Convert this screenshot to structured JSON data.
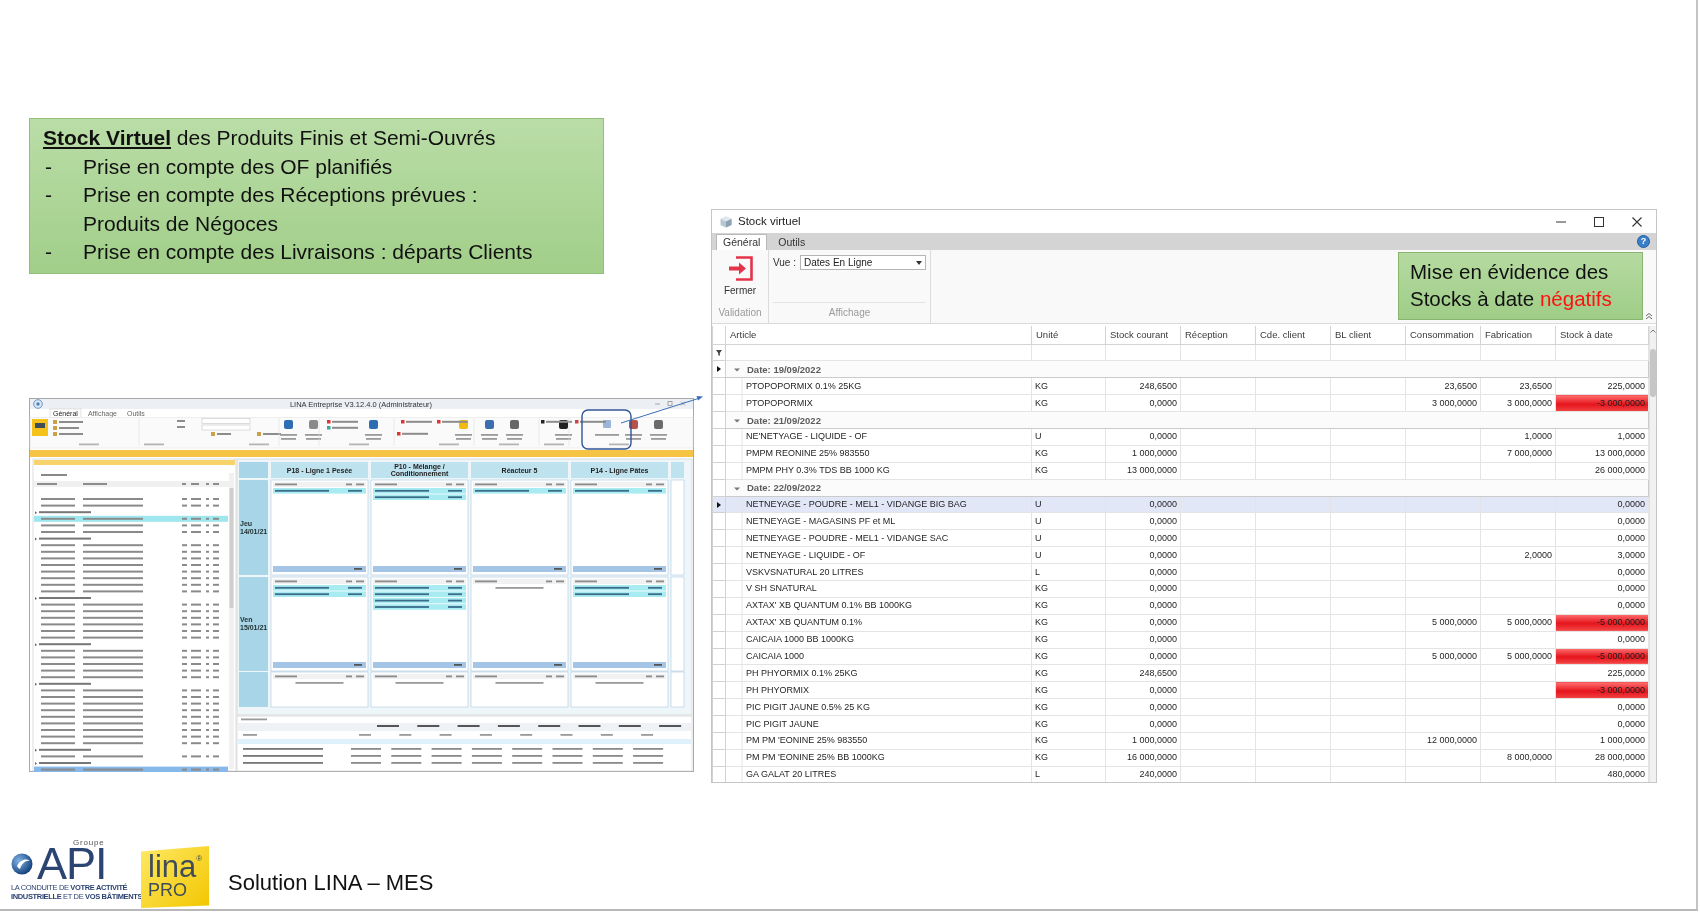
{
  "intro_box": {
    "title": "**Stock Virtuel** des Produits Finis et Semi-Ouvrés",
    "bullets": [
      {
        "marker": "-",
        "lines": [
          "Prise en compte des OF planifiés"
        ]
      },
      {
        "marker": "-",
        "lines": [
          "Prise en compte des Réceptions prévues :",
          "Produits de Négoces"
        ]
      },
      {
        "marker": "-",
        "lines": [
          "Prise en compte des Livraisons : départs Clients"
        ]
      }
    ]
  },
  "app_screenshot": {
    "title": "LINA Entreprise V3.12.4.0 (Administrateur)",
    "tabs": [
      {
        "label": "Général",
        "selected": true
      },
      {
        "label": "Affichage",
        "selected": false
      },
      {
        "label": "Outils",
        "selected": false
      }
    ],
    "resources": [
      "P18 - Ligne 1 Pesée",
      "P10 - Mélange / Conditionnement",
      "Réacteur 5",
      "P14 - Ligne Pâtes"
    ],
    "days": [
      {
        "day": "Jeu",
        "date": "14/01/21"
      },
      {
        "day": "Ven",
        "date": "15/01/21"
      }
    ]
  },
  "stock_window": {
    "title": "Stock virtuel",
    "tabs": [
      {
        "label": "Général",
        "selected": true
      },
      {
        "label": "Outils",
        "selected": false
      }
    ],
    "help_label": "?",
    "ribbon": {
      "groups": [
        {
          "kind": "buttons",
          "label": "Validation",
          "buttons": [
            "Fermer"
          ]
        },
        {
          "kind": "dropdown",
          "label": "Affichage",
          "field_label": "Vue :",
          "value": "Dates En Ligne"
        }
      ]
    },
    "callout": {
      "text": "Mise en évidence des Stocks à date",
      "highlight": "négatifs"
    },
    "table": {
      "columns": [
        "Article",
        "Unité",
        "Stock courant",
        "Réception",
        "Cde. client",
        "BL client",
        "Consommation",
        "Fabrication",
        "Stock à date"
      ],
      "groups": [
        {
          "label": "Date: 19/09/2022",
          "expanded": true,
          "selected": true,
          "rows": [
            {
              "article": "PTOPOPORMIX 0.1% 25KG",
              "unite": "KG",
              "stock_courant": "248,6500",
              "consommation": "23,6500",
              "fabrication": "23,6500",
              "stock_a_date": "225,0000",
              "negative": false,
              "selected": false
            },
            {
              "article": "PTOPOPORMIX",
              "unite": "KG",
              "stock_courant": "0,0000",
              "consommation": "3 000,0000",
              "fabrication": "3 000,0000",
              "stock_a_date": "-3 000,0000",
              "negative": true,
              "selected": false
            }
          ]
        },
        {
          "label": "Date: 21/09/2022",
          "expanded": true,
          "selected": false,
          "rows": [
            {
              "article": "NE'NETYAGE - LIQUIDE - OF",
              "unite": "U",
              "stock_courant": "0,0000",
              "fabrication": "1,0000",
              "stock_a_date": "1,0000",
              "negative": false,
              "selected": false
            },
            {
              "article": "PMPM REONINE 25% 983550",
              "unite": "KG",
              "stock_courant": "1 000,0000",
              "fabrication": "7 000,0000",
              "stock_a_date": "13 000,0000",
              "negative": false,
              "selected": false
            },
            {
              "article": "PMPM PHY 0.3% TDS BB 1000 KG",
              "unite": "KG",
              "stock_courant": "13 000,0000",
              "stock_a_date": "26 000,0000",
              "negative": false,
              "selected": false
            }
          ]
        },
        {
          "label": "Date: 22/09/2022",
          "expanded": true,
          "selected": false,
          "rows": [
            {
              "article": "NETNEYAGE - POUDRE - MEL1 - VIDANGE BIG BAG",
              "unite": "U",
              "stock_courant": "0,0000",
              "stock_a_date": "0,0000",
              "negative": false,
              "selected": true
            },
            {
              "article": "NETNEYAGE - MAGASINS PF et ML",
              "unite": "U",
              "stock_courant": "0,0000",
              "stock_a_date": "0,0000",
              "negative": false,
              "selected": false
            },
            {
              "article": "NETNEYAGE - POUDRE - MEL1 - VIDANGE SAC",
              "unite": "U",
              "stock_courant": "0,0000",
              "stock_a_date": "0,0000",
              "negative": false,
              "selected": false
            },
            {
              "article": "NETNEYAGE - LIQUIDE - OF",
              "unite": "U",
              "stock_courant": "0,0000",
              "fabrication": "2,0000",
              "stock_a_date": "3,0000",
              "negative": false,
              "selected": false
            },
            {
              "article": "VSKVSNATURAL 20 LITRES",
              "unite": "L",
              "stock_courant": "0,0000",
              "stock_a_date": "0,0000",
              "negative": false,
              "selected": false
            },
            {
              "article": "V SH SNATURAL",
              "unite": "KG",
              "stock_courant": "0,0000",
              "stock_a_date": "0,0000",
              "negative": false,
              "selected": false
            },
            {
              "article": "AXTAX' XB QUANTUM 0.1% BB 1000KG",
              "unite": "KG",
              "stock_courant": "0,0000",
              "stock_a_date": "0,0000",
              "negative": false,
              "selected": false
            },
            {
              "article": "AXTAX' XB QUANTUM 0.1%",
              "unite": "KG",
              "stock_courant": "0,0000",
              "consommation": "5 000,0000",
              "fabrication": "5 000,0000",
              "stock_a_date": "-5 000,0000",
              "negative": true,
              "selected": false
            },
            {
              "article": "CAICAIA 1000 BB 1000KG",
              "unite": "KG",
              "stock_courant": "0,0000",
              "stock_a_date": "0,0000",
              "negative": false,
              "selected": false
            },
            {
              "article": "CAICAIA 1000",
              "unite": "KG",
              "stock_courant": "0,0000",
              "consommation": "5 000,0000",
              "fabrication": "5 000,0000",
              "stock_a_date": "-5 000,0000",
              "negative": true,
              "selected": false
            },
            {
              "article": "PH PHYORMIX 0.1% 25KG",
              "unite": "KG",
              "stock_courant": "248,6500",
              "stock_a_date": "225,0000",
              "negative": false,
              "selected": false
            },
            {
              "article": "PH PHYORMIX",
              "unite": "KG",
              "stock_courant": "0,0000",
              "stock_a_date": "-3 000,0000",
              "negative": true,
              "selected": false
            },
            {
              "article": "PIC PIGIT JAUNE 0.5% 25 KG",
              "unite": "KG",
              "stock_courant": "0,0000",
              "stock_a_date": "0,0000",
              "negative": false,
              "selected": false
            },
            {
              "article": "PIC PIGIT JAUNE",
              "unite": "KG",
              "stock_courant": "0,0000",
              "stock_a_date": "0,0000",
              "negative": false,
              "selected": false
            },
            {
              "article": "PM PM 'EONINE 25% 983550",
              "unite": "KG",
              "stock_courant": "1 000,0000",
              "consommation": "12 000,0000",
              "stock_a_date": "1 000,0000",
              "negative": false,
              "selected": false
            },
            {
              "article": "PM PM 'EONINE 25% BB 1000KG",
              "unite": "KG",
              "stock_courant": "16 000,0000",
              "fabrication": "8 000,0000",
              "stock_a_date": "28 000,0000",
              "negative": false,
              "selected": false
            },
            {
              "article": "GA GALAT 20 LITRES",
              "unite": "L",
              "stock_courant": "240,0000",
              "stock_a_date": "480,0000",
              "negative": false,
              "selected": false
            }
          ]
        }
      ]
    }
  },
  "footer": {
    "api_logo": {
      "group_label": "Groupe",
      "wordmark": "API",
      "tagline": [
        "LA CONDUITE DE **VOTRE ACTIVITÉ**",
        "**INDUSTRIELLE** ET DE **VOS BÂTIMENTS**"
      ]
    },
    "lina_logo": {
      "wordmark": "lina$^{®}$",
      "edition": "PRO"
    },
    "caption": "Solution LINA – MES"
  }
}
